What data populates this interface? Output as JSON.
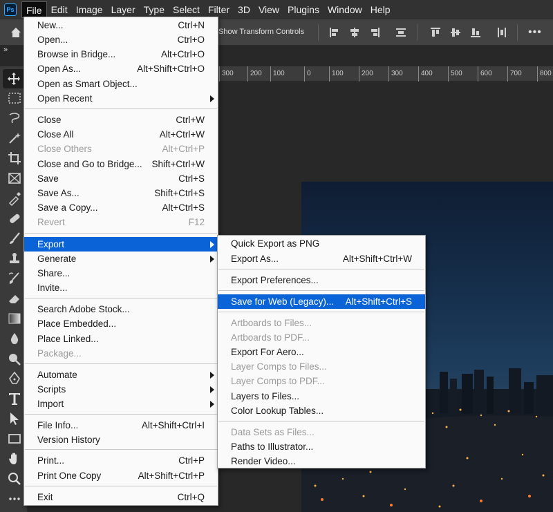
{
  "menubar": {
    "logo": "Ps",
    "items": [
      "File",
      "Edit",
      "Image",
      "Layer",
      "Type",
      "Select",
      "Filter",
      "3D",
      "View",
      "Plugins",
      "Window",
      "Help"
    ],
    "active_index": 0
  },
  "options_bar": {
    "transform_label": "Show Transform Controls",
    "more_label": "•••"
  },
  "tabstrip": {
    "collapse_label": "»"
  },
  "ruler": {
    "ticks": [
      "300",
      "200",
      "100",
      "0",
      "100",
      "200",
      "300",
      "400",
      "500",
      "600",
      "700",
      "800"
    ]
  },
  "file_menu": {
    "items": [
      {
        "label": "New...",
        "shortcut": "Ctrl+N",
        "disabled": false,
        "submenu": false
      },
      {
        "label": "Open...",
        "shortcut": "Ctrl+O",
        "disabled": false,
        "submenu": false
      },
      {
        "label": "Browse in Bridge...",
        "shortcut": "Alt+Ctrl+O",
        "disabled": false,
        "submenu": false
      },
      {
        "label": "Open As...",
        "shortcut": "Alt+Shift+Ctrl+O",
        "disabled": false,
        "submenu": false
      },
      {
        "label": "Open as Smart Object...",
        "shortcut": "",
        "disabled": false,
        "submenu": false
      },
      {
        "label": "Open Recent",
        "shortcut": "",
        "disabled": false,
        "submenu": true
      },
      {
        "label": "Close",
        "shortcut": "Ctrl+W",
        "disabled": false,
        "submenu": false
      },
      {
        "label": "Close All",
        "shortcut": "Alt+Ctrl+W",
        "disabled": false,
        "submenu": false
      },
      {
        "label": "Close Others",
        "shortcut": "Alt+Ctrl+P",
        "disabled": true,
        "submenu": false
      },
      {
        "label": "Close and Go to Bridge...",
        "shortcut": "Shift+Ctrl+W",
        "disabled": false,
        "submenu": false
      },
      {
        "label": "Save",
        "shortcut": "Ctrl+S",
        "disabled": false,
        "submenu": false
      },
      {
        "label": "Save As...",
        "shortcut": "Shift+Ctrl+S",
        "disabled": false,
        "submenu": false
      },
      {
        "label": "Save a Copy...",
        "shortcut": "Alt+Ctrl+S",
        "disabled": false,
        "submenu": false
      },
      {
        "label": "Revert",
        "shortcut": "F12",
        "disabled": true,
        "submenu": false
      },
      {
        "label": "Export",
        "shortcut": "",
        "disabled": false,
        "submenu": true,
        "highlighted": true
      },
      {
        "label": "Generate",
        "shortcut": "",
        "disabled": false,
        "submenu": true
      },
      {
        "label": "Share...",
        "shortcut": "",
        "disabled": false,
        "submenu": false
      },
      {
        "label": "Invite...",
        "shortcut": "",
        "disabled": false,
        "submenu": false
      },
      {
        "label": "Search Adobe Stock...",
        "shortcut": "",
        "disabled": false,
        "submenu": false
      },
      {
        "label": "Place Embedded...",
        "shortcut": "",
        "disabled": false,
        "submenu": false
      },
      {
        "label": "Place Linked...",
        "shortcut": "",
        "disabled": false,
        "submenu": false
      },
      {
        "label": "Package...",
        "shortcut": "",
        "disabled": true,
        "submenu": false
      },
      {
        "label": "Automate",
        "shortcut": "",
        "disabled": false,
        "submenu": true
      },
      {
        "label": "Scripts",
        "shortcut": "",
        "disabled": false,
        "submenu": true
      },
      {
        "label": "Import",
        "shortcut": "",
        "disabled": false,
        "submenu": true
      },
      {
        "label": "File Info...",
        "shortcut": "Alt+Shift+Ctrl+I",
        "disabled": false,
        "submenu": false
      },
      {
        "label": "Version History",
        "shortcut": "",
        "disabled": false,
        "submenu": false
      },
      {
        "label": "Print...",
        "shortcut": "Ctrl+P",
        "disabled": false,
        "submenu": false
      },
      {
        "label": "Print One Copy",
        "shortcut": "Alt+Shift+Ctrl+P",
        "disabled": false,
        "submenu": false
      },
      {
        "label": "Exit",
        "shortcut": "Ctrl+Q",
        "disabled": false,
        "submenu": false
      }
    ]
  },
  "export_menu": {
    "items": [
      {
        "label": "Quick Export as PNG",
        "shortcut": "",
        "disabled": false
      },
      {
        "label": "Export As...",
        "shortcut": "Alt+Shift+Ctrl+W",
        "disabled": false
      },
      {
        "label": "Export Preferences...",
        "shortcut": "",
        "disabled": false
      },
      {
        "label": "Save for Web (Legacy)...",
        "shortcut": "Alt+Shift+Ctrl+S",
        "disabled": false,
        "highlighted": true
      },
      {
        "label": "Artboards to Files...",
        "shortcut": "",
        "disabled": true
      },
      {
        "label": "Artboards to PDF...",
        "shortcut": "",
        "disabled": true
      },
      {
        "label": "Export For Aero...",
        "shortcut": "",
        "disabled": false
      },
      {
        "label": "Layer Comps to Files...",
        "shortcut": "",
        "disabled": true
      },
      {
        "label": "Layer Comps to PDF...",
        "shortcut": "",
        "disabled": true
      },
      {
        "label": "Layers to Files...",
        "shortcut": "",
        "disabled": false
      },
      {
        "label": "Color Lookup Tables...",
        "shortcut": "",
        "disabled": false
      },
      {
        "label": "Data Sets as Files...",
        "shortcut": "",
        "disabled": true
      },
      {
        "label": "Paths to Illustrator...",
        "shortcut": "",
        "disabled": false
      },
      {
        "label": "Render Video...",
        "shortcut": "",
        "disabled": false
      }
    ]
  },
  "colors": {
    "highlight": "#0a64d8",
    "menu_bg": "#fafafa",
    "disabled_text": "#9a9a9a",
    "app_bg": "#323232"
  }
}
